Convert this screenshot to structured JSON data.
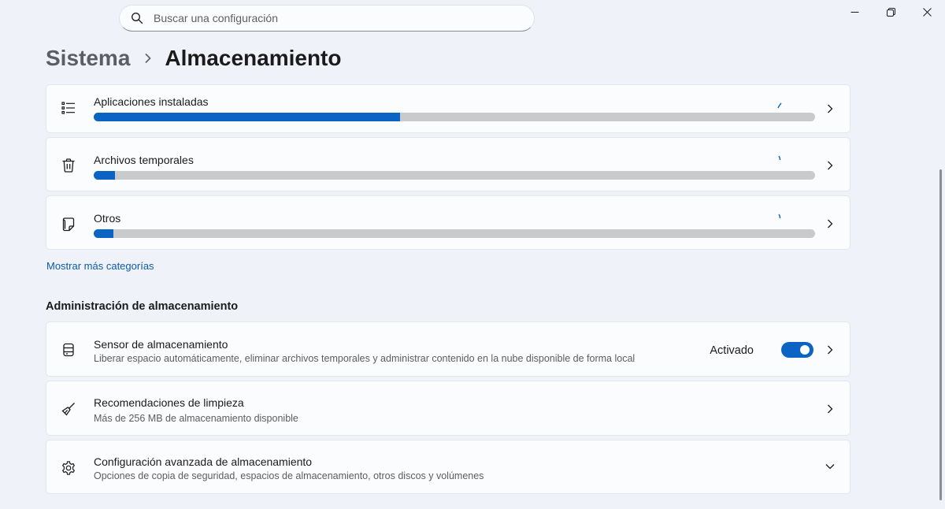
{
  "search": {
    "placeholder": "Buscar una configuración"
  },
  "window_controls": {
    "minimize_icon": "minimize-icon",
    "maximize_icon": "restore-icon",
    "close_icon": "close-icon"
  },
  "breadcrumb": {
    "parent": "Sistema",
    "current": "Almacenamiento"
  },
  "categories": [
    {
      "label": "Aplicaciones instaladas",
      "icon": "list-icon",
      "usage_percent": 42.5
    },
    {
      "label": "Archivos temporales",
      "icon": "trash-icon",
      "usage_percent": 3
    },
    {
      "label": "Otros",
      "icon": "document-icon",
      "usage_percent": 2.7
    }
  ],
  "show_more_label": "Mostrar más categorías",
  "section_title": "Administración de almacenamiento",
  "management": [
    {
      "title": "Sensor de almacenamiento",
      "desc": "Liberar espacio automáticamente, eliminar archivos temporales y administrar contenido en la nube disponible de forma local",
      "status": "Activado",
      "icon": "storage-sense-icon"
    },
    {
      "title": "Recomendaciones de limpieza",
      "desc": "Más de 256 MB de almacenamiento disponible",
      "icon": "broom-icon"
    },
    {
      "title": "Configuración avanzada de almacenamiento",
      "desc": "Opciones de copia de seguridad, espacios de almacenamiento, otros discos y volúmenes",
      "icon": "gear-icon"
    }
  ],
  "colors": {
    "accent": "#0b63c4",
    "bar_track": "#c9cacc",
    "link": "#0b5aa8"
  }
}
